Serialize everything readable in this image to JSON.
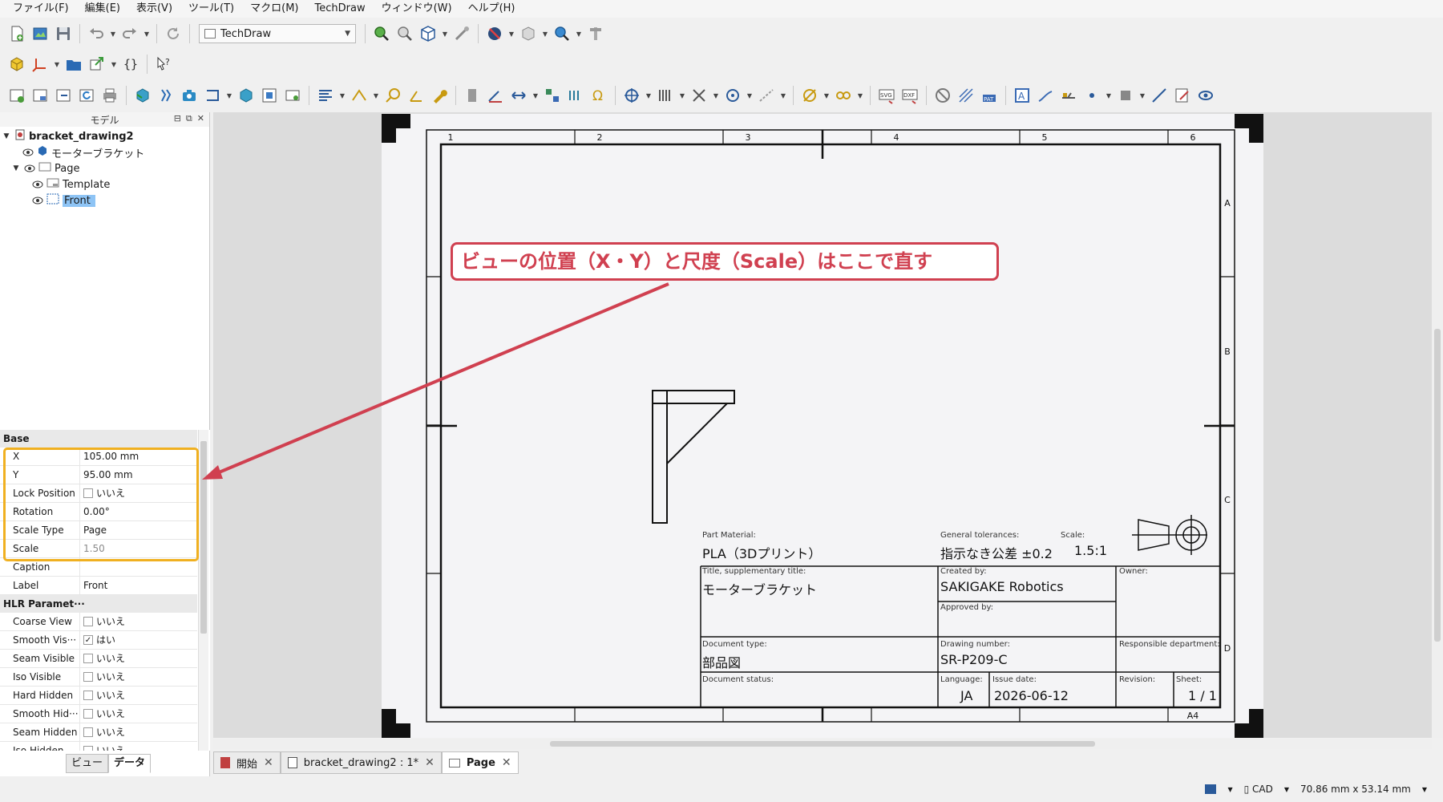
{
  "menu": [
    "ファイル(F)",
    "編集(E)",
    "表示(V)",
    "ツール(T)",
    "マクロ(M)",
    "TechDraw",
    "ウィンドウ(W)",
    "ヘルプ(H)"
  ],
  "toolbar": {
    "workbench": "TechDraw"
  },
  "tree": {
    "header": "モデル",
    "doc": "bracket_drawing2",
    "part": "モーターブラケット",
    "page": "Page",
    "template": "Template",
    "view": "Front"
  },
  "props": {
    "group_base": "Base",
    "rows": [
      {
        "name": "X",
        "value": "105.00 mm"
      },
      {
        "name": "Y",
        "value": "95.00 mm"
      },
      {
        "name": "Lock Position",
        "value": "いいえ"
      },
      {
        "name": "Rotation",
        "value": "0.00°"
      },
      {
        "name": "Scale Type",
        "value": "Page"
      },
      {
        "name": "Scale",
        "value": "1.50"
      },
      {
        "name": "Caption",
        "value": ""
      },
      {
        "name": "Label",
        "value": "Front"
      }
    ],
    "group_hlr": "HLR Paramet···",
    "hlr": [
      {
        "name": "Coarse View",
        "value": "いいえ"
      },
      {
        "name": "Smooth Vis···",
        "value": "はい",
        "check": "✓"
      },
      {
        "name": "Seam Visible",
        "value": "いいえ"
      },
      {
        "name": "Iso Visible",
        "value": "いいえ"
      },
      {
        "name": "Hard Hidden",
        "value": "いいえ"
      },
      {
        "name": "Smooth Hid···",
        "value": "いいえ"
      },
      {
        "name": "Seam Hidden",
        "value": "いいえ"
      },
      {
        "name": "Iso Hidden",
        "value": "いいえ"
      }
    ]
  },
  "panel_tabs": [
    "ビュー",
    "データ"
  ],
  "doc_tabs": [
    "開始",
    "bracket_drawing2 : 1*",
    "Page"
  ],
  "status": {
    "nav": "CAD",
    "dims": "70.86 mm x 53.14 mm"
  },
  "annotation": "ビューの位置（X・Y）と尺度（Scale）はここで直す",
  "sheet": {
    "cols": [
      "1",
      "2",
      "3",
      "4",
      "5",
      "6"
    ],
    "rows": [
      "A",
      "B",
      "C",
      "D"
    ],
    "size": "A4",
    "title_block": {
      "part_material_label": "Part Material:",
      "part_material": "PLA（3Dプリント）",
      "tolerance_label": "General tolerances:",
      "tolerance": "指示なき公差 ±0.2",
      "scale_label": "Scale:",
      "scale": "1.5:1",
      "title_label": "Title, supplementary title:",
      "title": "モーターブラケット",
      "created_label": "Created by:",
      "created": "SAKIGAKE Robotics",
      "owner_label": "Owner:",
      "approved_label": "Approved by:",
      "doctype_label": "Document type:",
      "doctype": "部品図",
      "drawing_no_label": "Drawing number:",
      "drawing_no": "SR-P209-C",
      "resp_label": "Responsible department:",
      "status_label": "Document status:",
      "lang_label": "Language:",
      "lang": "JA",
      "issue_label": "Issue date:",
      "issue": "2026-06-12",
      "revision_label": "Revision:",
      "sheet_label": "Sheet:",
      "sheet": "1 / 1"
    }
  }
}
